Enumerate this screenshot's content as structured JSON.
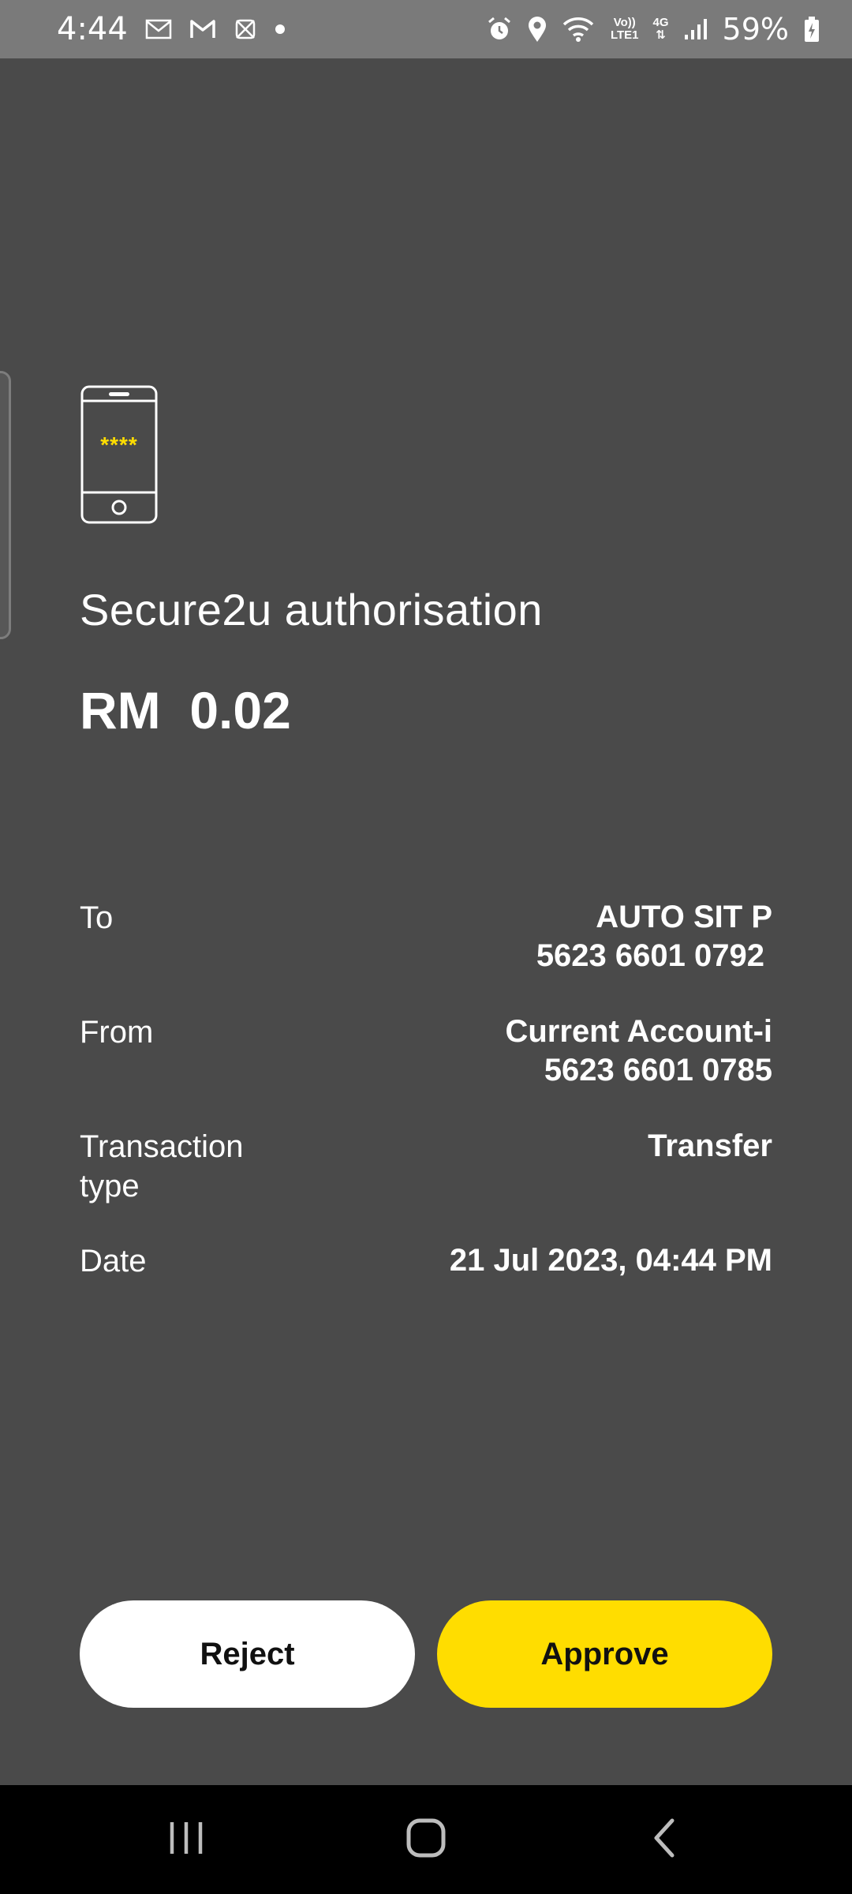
{
  "status_bar": {
    "time": "4:44",
    "network_top": "Vo))",
    "network_bottom": "LTE1",
    "network_gen": "4G",
    "battery": "59%",
    "icons": [
      "mail-icon",
      "gmail-icon",
      "app-icon",
      "dot-icon",
      "alarm-icon",
      "location-icon",
      "wifi-icon",
      "signal-icon",
      "battery-icon"
    ]
  },
  "auth": {
    "icon": "phone-pin-icon",
    "pin_mask": "****",
    "title": "Secure2u authorisation",
    "amount": "RM  0.02"
  },
  "details": {
    "to_label": "To",
    "to_name": "AUTO SIT P",
    "to_account": "5623 6601 0792",
    "from_label": "From",
    "from_name": "Current Account-i",
    "from_account": "5623 6601 0785",
    "type_label_line1": "Transaction",
    "type_label_line2": "type",
    "type_value": "Transfer",
    "date_label": "Date",
    "date_value": "21 Jul 2023, 04:44 PM"
  },
  "actions": {
    "reject_label": "Reject",
    "approve_label": "Approve"
  },
  "nav": {
    "icons": [
      "recent-apps-icon",
      "home-icon",
      "back-icon"
    ]
  },
  "colors": {
    "background": "#4a4a4a",
    "status_bar": "#7a7a7a",
    "accent": "#ffdd00",
    "nav_bar": "#000000"
  }
}
